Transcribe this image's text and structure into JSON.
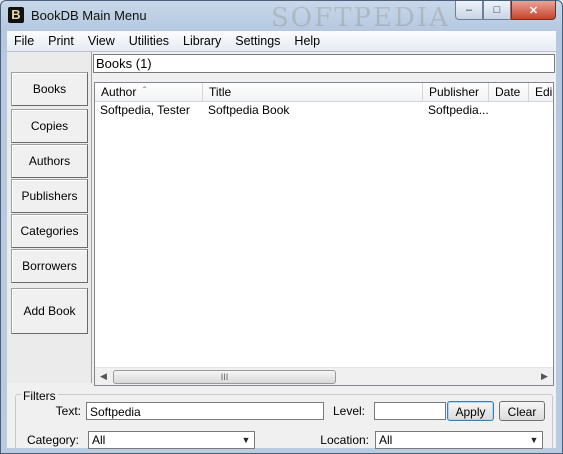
{
  "window": {
    "title": "BookDB Main Menu",
    "icon": "app-b-icon"
  },
  "caption_buttons": {
    "minimize": "–",
    "maximize": "□",
    "close": "✕"
  },
  "menu": [
    "File",
    "Print",
    "View",
    "Utilities",
    "Library",
    "Settings",
    "Help"
  ],
  "sidebar": [
    "Books",
    "Copies",
    "Authors",
    "Publishers",
    "Categories",
    "Borrowers",
    "Add Book"
  ],
  "header": {
    "label": "Books (1)"
  },
  "list": {
    "columns": [
      "Author",
      "Title",
      "Publisher",
      "Date",
      "Edi"
    ],
    "sort_indicator": "ˆ",
    "rows": [
      {
        "author": "Softpedia, Tester",
        "title": "Softpedia Book",
        "publisher": "Softpedia...",
        "date": "",
        "edition": ""
      }
    ]
  },
  "scrollbar": {
    "left": "◀",
    "right": "▶",
    "grip": "III"
  },
  "filters": {
    "legend": "Filters",
    "text_label": "Text:",
    "text_value": "Softpedia",
    "level_label": "Level:",
    "level_value": "",
    "apply": "Apply",
    "clear": "Clear",
    "category_label": "Category:",
    "category_value": "All",
    "location_label": "Location:",
    "location_value": "All",
    "dropdown_glyph": "▼"
  },
  "watermark": "SOFTPEDIA"
}
